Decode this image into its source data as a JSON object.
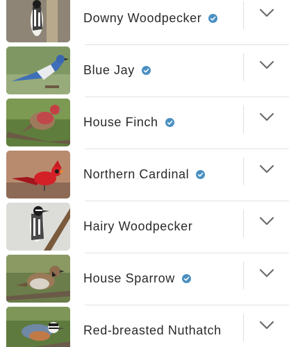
{
  "birds": [
    {
      "name": "Downy Woodpecker",
      "verified": true
    },
    {
      "name": "Blue Jay",
      "verified": true
    },
    {
      "name": "House Finch",
      "verified": true
    },
    {
      "name": "Northern Cardinal",
      "verified": true
    },
    {
      "name": "Hairy Woodpecker",
      "verified": false
    },
    {
      "name": "House Sparrow",
      "verified": true
    },
    {
      "name": "Red-breasted Nuthatch",
      "verified": false
    }
  ],
  "icons": {
    "verified": "verified-check-icon",
    "expand": "chevron-down-icon"
  },
  "colors": {
    "verified_badge": "#4a90c2",
    "chevron": "#6b6b6b",
    "text": "#2a2a2a"
  }
}
